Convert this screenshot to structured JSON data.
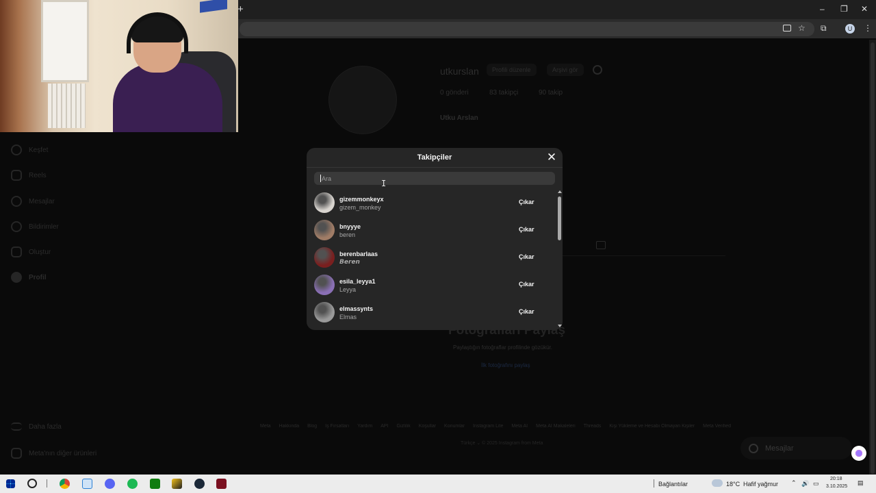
{
  "browser": {
    "new_tab_symbol": "+",
    "window_controls": [
      "–",
      "❐",
      "✕"
    ],
    "toolbar_icons": [
      "install-icon",
      "star-icon",
      "extensions-icon",
      "profile-avatar",
      "menu-icon"
    ],
    "profile_initial": "U",
    "menu_symbol": "⋮",
    "star_symbol": "☆",
    "extensions_symbol": "⧉"
  },
  "profile": {
    "username": "utkurslan",
    "edit_button": "Profili düzenle",
    "archive_button": "Arşivi gör",
    "posts": "0 gönderi",
    "followers": "83 takipçi",
    "following": "90 takip",
    "full_name": "Utku Arslan",
    "share_heading": "Fotoğrafları Paylaş",
    "share_sub": "Paylaştığın fotoğraflar profilinde gözükür.",
    "share_link": "İlk fotoğrafını paylaş"
  },
  "sidebar": {
    "items": [
      {
        "label": "Keşfet",
        "icon": "compass-icon"
      },
      {
        "label": "Reels",
        "icon": "reels-icon"
      },
      {
        "label": "Mesajlar",
        "icon": "messenger-icon"
      },
      {
        "label": "Bildirimler",
        "icon": "heart-icon"
      },
      {
        "label": "Oluştur",
        "icon": "plus-square-icon"
      },
      {
        "label": "Profil",
        "icon": "profile-avatar"
      }
    ],
    "more": "Daha fazla",
    "meta_products": "Meta'nın diğer ürünleri"
  },
  "footer": {
    "links": [
      "Meta",
      "Hakkında",
      "Blog",
      "İş Fırsatları",
      "Yardım",
      "API",
      "Gizlilik",
      "Koşullar",
      "Konumlar",
      "Instagram Lite",
      "Meta AI",
      "Meta AI Makaleleri",
      "Threads",
      "Kişi Yükleme ve Hesabı Olmayan Kişiler",
      "Meta Verified"
    ],
    "copyright": "Türkçe ⌄   © 2025 Instagram from Meta"
  },
  "messages_pill": {
    "label": "Mesajlar"
  },
  "modal": {
    "title": "Takipçiler",
    "close_symbol": "✕",
    "search_placeholder": "Ara",
    "remove_label": "Çıkar",
    "followers": [
      {
        "username": "gizemmonkeyx",
        "name": "gizem_monkey",
        "avatar_color": "#d8d4cf"
      },
      {
        "username": "bnyyye",
        "name": "beren",
        "avatar_color": "#a07c66"
      },
      {
        "username": "berenbarlaas",
        "name": "𝘽𝙚𝙧𝙚𝙣",
        "avatar_color": "#7a1f1f"
      },
      {
        "username": "esila_leyya1",
        "name": "Leyya",
        "avatar_color": "#8a6fb5"
      },
      {
        "username": "elmassynts",
        "name": "Elmas",
        "avatar_color": "#9a9a9a"
      }
    ]
  },
  "taskbar": {
    "apps": [
      "windows-start-icon",
      "search-icon",
      "chrome-icon",
      "vpn-icon",
      "discord-icon",
      "spotify-icon",
      "xbox-icon",
      "valorant-icon",
      "steam-icon",
      "app-icon"
    ],
    "connection": "Bağlantılar",
    "temperature": "18°C",
    "weather": "Hafif yağmur",
    "time": "20:18",
    "date": "3.10.2025"
  }
}
